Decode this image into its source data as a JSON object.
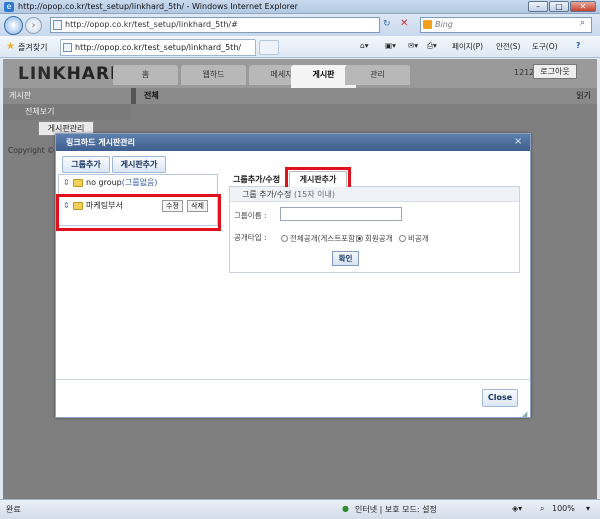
{
  "browser": {
    "title": "http://opop.co.kr/test_setup/linkhard_5th/ - Windows Internet Explorer",
    "url": "http://opop.co.kr/test_setup/linkhard_5th/#",
    "search_placeholder": "Bing",
    "favorites_label": "즐겨찾기",
    "tab_title": "http://opop.co.kr/test_setup/linkhard_5th/",
    "cmd_page": "페이지(P)",
    "cmd_safety": "안전(S)",
    "cmd_tools": "도구(O)",
    "cmd_help": "?",
    "status_done": "완료",
    "status_zone": "인터넷 | 보호 모드: 설정",
    "status_zoom": "100%"
  },
  "site": {
    "logo_a": "LINK",
    "logo_b": "HARD",
    "tabs": [
      "홈",
      "웹하드",
      "메세지",
      "게시판",
      "관리"
    ],
    "user_number": "1212",
    "logout_label": "로그아웃",
    "sidebar_header": "게시판",
    "sidebar_all": "전체보기",
    "sidebar_manage": "게시판관리",
    "main_header": "전체",
    "main_header_right": "읽기",
    "copyright": "Copyright © 20"
  },
  "dialog": {
    "title": "링크하드 게시판관리",
    "close_x": "×",
    "add_group_btn": "그룹추가",
    "add_board_btn": "게시판추가",
    "groups": [
      {
        "name": "no group",
        "sub": "(그룹없음)"
      },
      {
        "name": "마케팅부서",
        "edit": "수정",
        "delete": "삭제"
      }
    ],
    "right_tab1": "그룹추가/수정",
    "right_tab2": "게시판추가",
    "form_header": "그룹 추가/수정",
    "form_hint": "(15자 이내)",
    "name_label": "그룹이름 :",
    "name_value": "",
    "visibility_label": "공개타입 :",
    "visibility_options": [
      "전체공개(게스트포함)",
      "회원공개",
      "비공개"
    ],
    "visibility_selected": "회원공개",
    "confirm_label": "확인",
    "close_label": "Close"
  }
}
